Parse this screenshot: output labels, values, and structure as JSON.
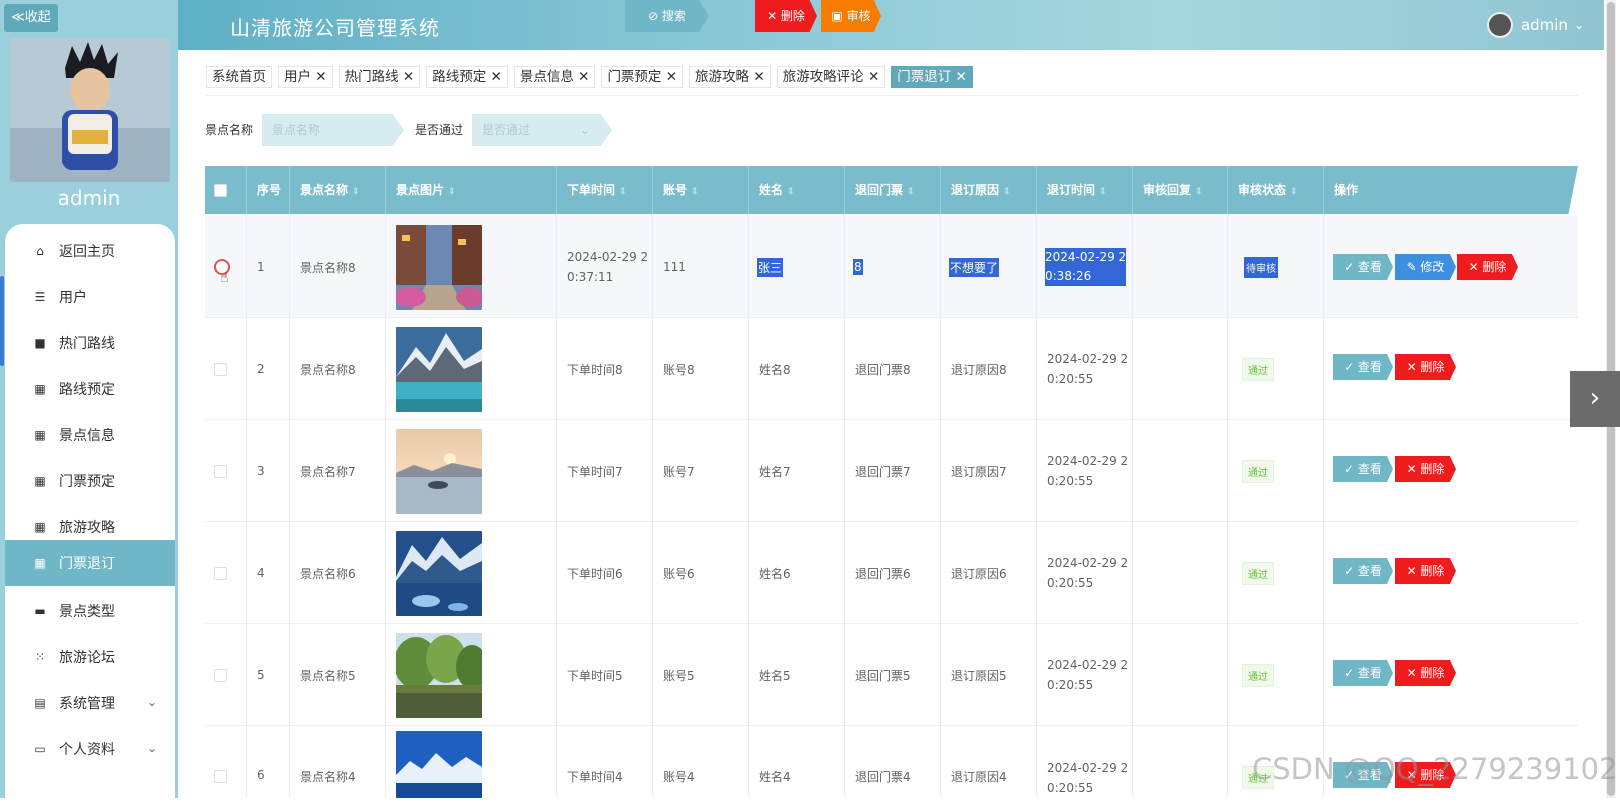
{
  "sidebar": {
    "collapse_label": "≪收起",
    "admin_name": "admin",
    "items": [
      {
        "label": "返回主页",
        "icon": "home-icon"
      },
      {
        "label": "用户",
        "icon": "sliders-icon"
      },
      {
        "label": "热门路线",
        "icon": "briefcase-icon"
      },
      {
        "label": "路线预定",
        "icon": "grid-icon"
      },
      {
        "label": "景点信息",
        "icon": "grid-icon"
      },
      {
        "label": "门票预定",
        "icon": "grid-icon"
      },
      {
        "label": "旅游攻略",
        "icon": "grid-icon"
      },
      {
        "label": "门票退订",
        "icon": "grid-icon"
      },
      {
        "label": "景点类型",
        "icon": "wallet-icon"
      },
      {
        "label": "旅游论坛",
        "icon": "apps-icon"
      },
      {
        "label": "系统管理",
        "icon": "clipboard-icon"
      },
      {
        "label": "个人资料",
        "icon": "card-icon"
      }
    ]
  },
  "header": {
    "title": "山清旅游公司管理系统",
    "user": "admin"
  },
  "tags": [
    {
      "label": "系统首页"
    },
    {
      "label": "用户 ✕"
    },
    {
      "label": "热门路线 ✕"
    },
    {
      "label": "路线预定 ✕"
    },
    {
      "label": "景点信息 ✕"
    },
    {
      "label": "门票预定 ✕"
    },
    {
      "label": "旅游攻略 ✕"
    },
    {
      "label": "旅游攻略评论 ✕"
    },
    {
      "label": "门票退订 ✕"
    }
  ],
  "search": {
    "name_label": "景点名称",
    "name_placeholder": "景点名称",
    "pass_label": "是否通过",
    "pass_placeholder": "是否通过",
    "search_btn": "⊘ 搜索",
    "delete_btn": "✕ 删除",
    "audit_btn": "▣ 审核"
  },
  "table": {
    "headers": [
      "序号",
      "景点名称",
      "景点图片",
      "下单时间",
      "账号",
      "姓名",
      "退回门票",
      "退订原因",
      "退订时间",
      "审核回复",
      "审核状态",
      "操作"
    ],
    "rows": [
      {
        "no": "1",
        "name": "景点名称8",
        "time": "2024-02-29 2\n0:37:11",
        "account": "111",
        "uname": "张三",
        "ticket": "8",
        "reason": "不想要了",
        "rtime1": "2024-02-29 2",
        "rtime2": "0:38:26",
        "reply": "",
        "status": "待审核"
      },
      {
        "no": "2",
        "name": "景点名称8",
        "time": "下单时间8",
        "account": "账号8",
        "uname": "姓名8",
        "ticket": "退回门票8",
        "reason": "退订原因8",
        "rtime1": "2024-02-29 2",
        "rtime2": "0:20:55",
        "reply": "",
        "status": "通过"
      },
      {
        "no": "3",
        "name": "景点名称7",
        "time": "下单时间7",
        "account": "账号7",
        "uname": "姓名7",
        "ticket": "退回门票7",
        "reason": "退订原因7",
        "rtime1": "2024-02-29 2",
        "rtime2": "0:20:55",
        "reply": "",
        "status": "通过"
      },
      {
        "no": "4",
        "name": "景点名称6",
        "time": "下单时间6",
        "account": "账号6",
        "uname": "姓名6",
        "ticket": "退回门票6",
        "reason": "退订原因6",
        "rtime1": "2024-02-29 2",
        "rtime2": "0:20:55",
        "reply": "",
        "status": "通过"
      },
      {
        "no": "5",
        "name": "景点名称5",
        "time": "下单时间5",
        "account": "账号5",
        "uname": "姓名5",
        "ticket": "退回门票5",
        "reason": "退订原因5",
        "rtime1": "2024-02-29 2",
        "rtime2": "0:20:55",
        "reply": "",
        "status": "通过"
      },
      {
        "no": "6",
        "name": "景点名称4",
        "time": "下单时间4",
        "account": "账号4",
        "uname": "姓名4",
        "ticket": "退回门票4",
        "reason": "退订原因4",
        "rtime1": "2024-02-29 2",
        "rtime2": "0:20:55",
        "reply": "",
        "status": "通过"
      }
    ],
    "ops": {
      "view": "✓ 查看",
      "edit": "✎ 修改",
      "delete": "✕ 删除"
    }
  },
  "watermark": "CSDN @QQ_2279239102",
  "colors": {
    "accent": "#6fb7c7",
    "sidebar": "#9ad0dc",
    "danger": "#ee1c1c",
    "warning": "#f57c00"
  }
}
